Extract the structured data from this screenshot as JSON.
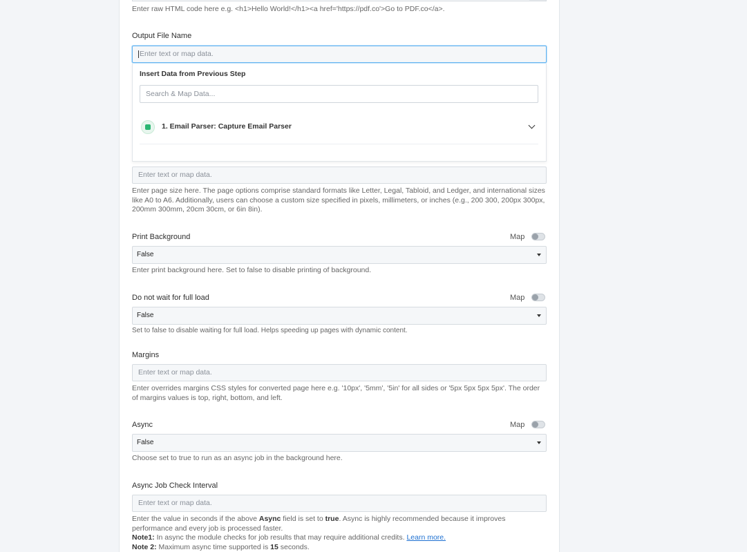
{
  "html_field": {
    "help": "Enter raw HTML code here e.g. <h1>Hello World!</h1><a href='https://pdf.co'>Go to PDF.co</a>."
  },
  "output_file_name": {
    "label": "Output File Name",
    "placeholder": "Enter text or map data."
  },
  "insert_data_dropdown": {
    "title": "Insert Data from Previous Step",
    "search_placeholder": "Search & Map Data...",
    "step_label": "1. Email Parser: Capture Email Parser",
    "step_icon": "email-parser-icon",
    "accent_color": "#2bb673"
  },
  "page_size": {
    "placeholder": "Enter text or map data.",
    "help": "Enter page size here. The page options comprise standard formats like Letter, Legal, Tabloid, and Ledger, and international sizes like A0 to A6. Additionally, users can choose a custom size specified in pixels, millimeters, or inches (e.g., 200 300, 200px 300px, 200mm 300mm, 20cm 30cm, or 6in 8in)."
  },
  "print_background": {
    "label": "Print Background",
    "map_label": "Map",
    "value": "False",
    "help": "Enter print background here. Set to false to disable printing of background."
  },
  "do_not_wait": {
    "label": "Do not wait for full load",
    "map_label": "Map",
    "value": "False",
    "help": "Set to false to disable waiting for full load. Helps speeding up pages with dynamic content."
  },
  "margins": {
    "label": "Margins",
    "placeholder": "Enter text or map data.",
    "help": "Enter overrides margins CSS styles for converted page here e.g. '10px', '5mm', '5in' for all sides or '5px 5px 5px 5px'. The order of margins values is top, right, bottom, and left."
  },
  "async": {
    "label": "Async",
    "map_label": "Map",
    "value": "False",
    "help": "Choose set to true to run as an async job in the background here."
  },
  "async_interval": {
    "label": "Async Job Check Interval",
    "placeholder": "Enter text or map data.",
    "help_1": "Enter the value in seconds if the above ",
    "help_bold_1": "Async",
    "help_2": " field is set to ",
    "help_bold_2": "true",
    "help_3": ". Async is highly recommended because it improves performance and every job is processed faster.",
    "note1_label": "Note1:",
    "note1_text": " In async the module checks for job results that may require additional credits. ",
    "note1_link": "Learn more.",
    "note2_label": "Note 2:",
    "note2_text_1": " Maximum async time supported is ",
    "note2_bold": "15",
    "note2_text_2": " seconds."
  },
  "colors": {
    "focus_border": "#66b5f0",
    "link": "#1c6fd1"
  }
}
